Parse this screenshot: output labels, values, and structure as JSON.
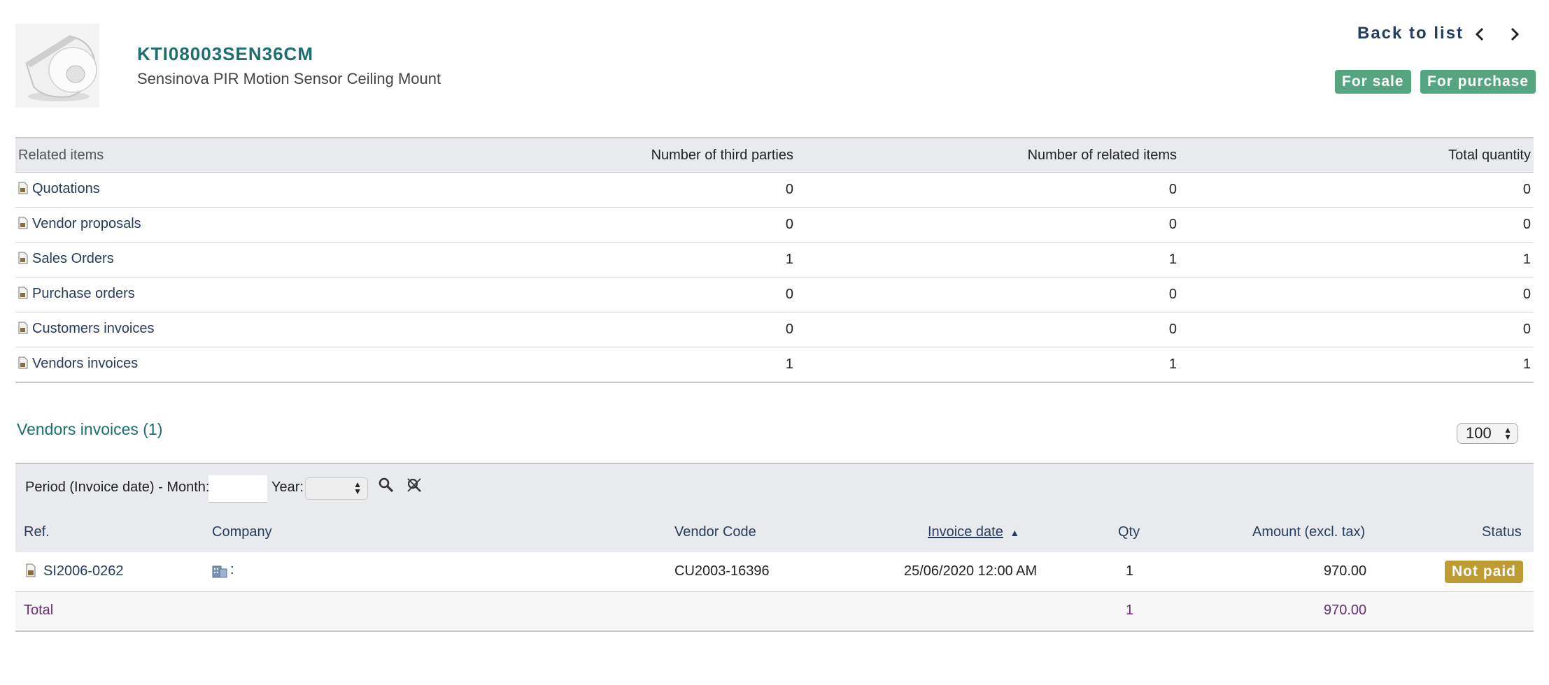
{
  "header": {
    "ref": "KTI08003SEN36CM",
    "label": "Sensinova PIR Motion Sensor Ceiling Mount",
    "back_to_list": "Back to list",
    "badges": [
      "For sale",
      "For purchase"
    ],
    "badge_color": "#55a580"
  },
  "related": {
    "columns": [
      "Related items",
      "Number of third parties",
      "Number of related items",
      "Total quantity"
    ],
    "rows": [
      {
        "label": "Quotations",
        "third_parties": "0",
        "related_items": "0",
        "total_qty": "0"
      },
      {
        "label": "Vendor proposals",
        "third_parties": "0",
        "related_items": "0",
        "total_qty": "0"
      },
      {
        "label": "Sales Orders",
        "third_parties": "1",
        "related_items": "1",
        "total_qty": "1"
      },
      {
        "label": "Purchase orders",
        "third_parties": "0",
        "related_items": "0",
        "total_qty": "0"
      },
      {
        "label": "Customers invoices",
        "third_parties": "0",
        "related_items": "0",
        "total_qty": "0"
      },
      {
        "label": "Vendors invoices",
        "third_parties": "1",
        "related_items": "1",
        "total_qty": "1"
      }
    ]
  },
  "invoices": {
    "title": "Vendors invoices (1)",
    "limit": "100",
    "filter": {
      "period_label": "Period (Invoice date) - Month:",
      "month_value": "",
      "year_label": "Year:",
      "year_value": ""
    },
    "columns": {
      "ref": "Ref.",
      "company": "Company",
      "vendor_code": "Vendor Code",
      "invoice_date": "Invoice date",
      "qty": "Qty",
      "amount": "Amount (excl. tax)",
      "status": "Status"
    },
    "rows": [
      {
        "ref": "SI2006-0262",
        "company": ":",
        "vendor_code": "CU2003-16396",
        "invoice_date": "25/06/2020 12:00 AM",
        "qty": "1",
        "amount": "970.00",
        "status": "Not paid"
      }
    ],
    "total": {
      "label": "Total",
      "qty": "1",
      "amount": "970.00"
    },
    "status_color": "#bf9b33"
  }
}
